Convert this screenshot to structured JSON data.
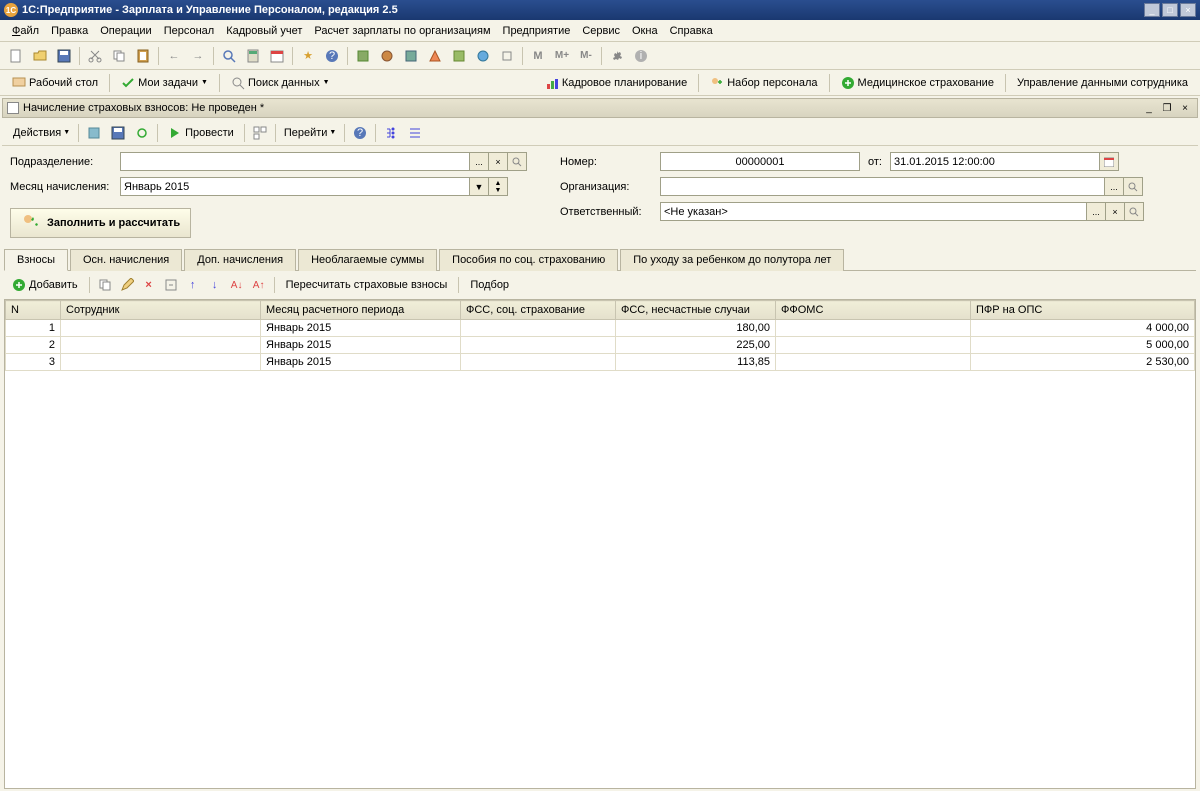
{
  "app": {
    "title": "1С:Предприятие - Зарплата и Управление Персоналом, редакция 2.5"
  },
  "menu": {
    "file": "Файл",
    "edit": "Правка",
    "ops": "Операции",
    "personnel": "Персонал",
    "hr": "Кадровый учет",
    "payroll": "Расчет зарплаты по организациям",
    "enterprise": "Предприятие",
    "service": "Сервис",
    "windows": "Окна",
    "help": "Справка"
  },
  "nav": {
    "desktop": "Рабочий стол",
    "tasks": "Мои задачи",
    "search": "Поиск данных",
    "hr_plan": "Кадровое планирование",
    "recruit": "Набор персонала",
    "medical": "Медицинское страхование",
    "employee_data": "Управление данными сотрудника"
  },
  "doc": {
    "title": "Начисление страховых взносов: Не проведен *",
    "actions": "Действия",
    "post": "Провести",
    "goto": "Перейти"
  },
  "form": {
    "subdivision_label": "Подразделение:",
    "subdivision_value": "",
    "month_label": "Месяц начисления:",
    "month_value": "Январь 2015",
    "fill_button": "Заполнить и рассчитать",
    "number_label": "Номер:",
    "number_value": "00000001",
    "date_label": "от:",
    "date_value": "31.01.2015 12:00:00",
    "org_label": "Организация:",
    "org_value": "",
    "responsible_label": "Ответственный:",
    "responsible_value": "<Не указан>"
  },
  "tabs": {
    "contributions": "Взносы",
    "main_accruals": "Осн. начисления",
    "add_accruals": "Доп. начисления",
    "nontax": "Необлагаемые суммы",
    "benefits": "Пособия по соц. страхованию",
    "childcare": "По уходу за ребенком до полутора лет"
  },
  "tab_toolbar": {
    "add": "Добавить",
    "recalc": "Пересчитать страховые взносы",
    "select": "Подбор"
  },
  "grid": {
    "columns": {
      "n": "N",
      "employee": "Сотрудник",
      "period_month": "Месяц расчетного периода",
      "fss_social": "ФСС, соц. страхование",
      "fss_accident": "ФСС, несчастные случаи",
      "ffoms": "ФФОМС",
      "pfr_ops": "ПФР на ОПС"
    },
    "rows": [
      {
        "n": "1",
        "employee": "",
        "period": "Январь 2015",
        "fss_social": "",
        "fss_accident": "180,00",
        "ffoms": "",
        "pfr_ops": "4 000,00"
      },
      {
        "n": "2",
        "employee": "",
        "period": "Январь 2015",
        "fss_social": "",
        "fss_accident": "225,00",
        "ffoms": "",
        "pfr_ops": "5 000,00"
      },
      {
        "n": "3",
        "employee": "",
        "period": "Январь 2015",
        "fss_social": "",
        "fss_accident": "113,85",
        "ffoms": "",
        "pfr_ops": "2 530,00"
      }
    ]
  }
}
